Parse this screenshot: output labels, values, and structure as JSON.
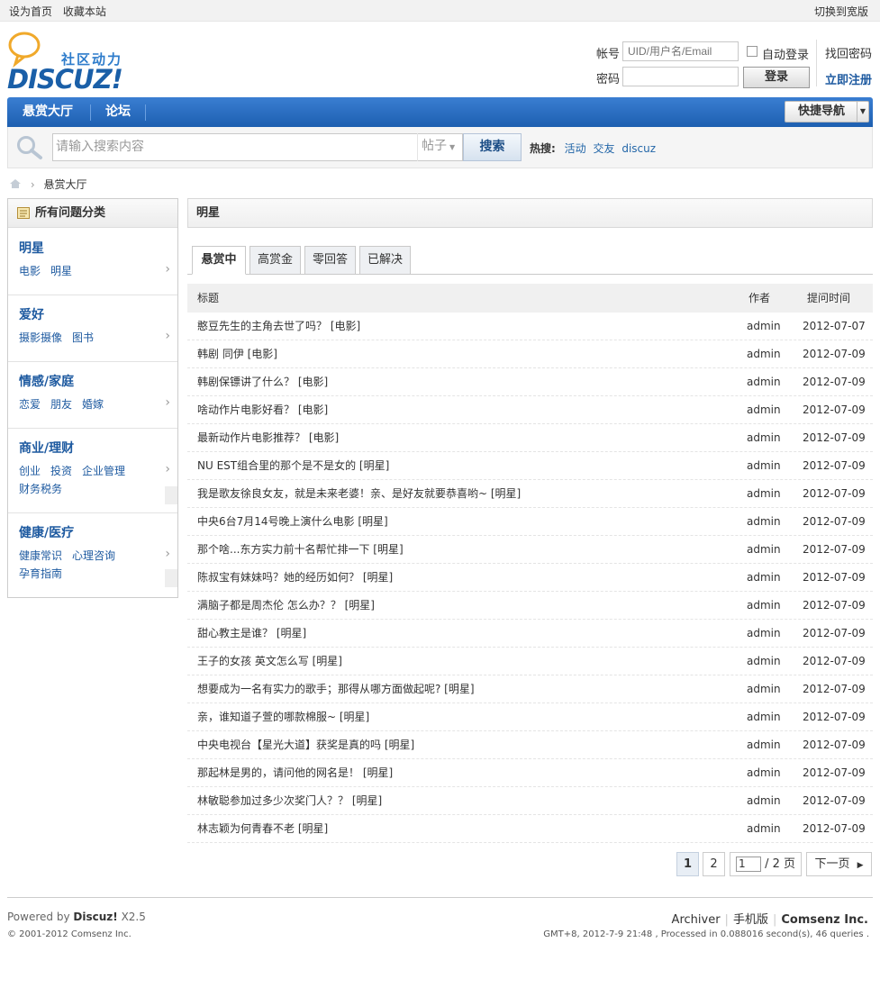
{
  "topbar": {
    "set_home": "设为首页",
    "bookmark": "收藏本站",
    "widescreen": "切换到宽版"
  },
  "logo": {
    "brand": "DISCUZ!",
    "tagline": "社区动力"
  },
  "login": {
    "account_label": "帐号",
    "account_placeholder": "UID/用户名/Email",
    "auto_login": "自动登录",
    "find_password": "找回密码",
    "password_label": "密码",
    "login_button": "登录",
    "register": "立即注册"
  },
  "nav": {
    "items": [
      "悬赏大厅",
      "论坛"
    ],
    "quick_nav": "快捷导航"
  },
  "search": {
    "placeholder": "请输入搜索内容",
    "type": "帖子",
    "button": "搜索",
    "hot_label": "热搜:",
    "hot": [
      "活动",
      "交友",
      "discuz"
    ]
  },
  "breadcrumb": {
    "current": "悬赏大厅"
  },
  "sidebar": {
    "title": "所有问题分类",
    "categories": [
      {
        "name": "明星",
        "subs": [
          "电影",
          "明星"
        ]
      },
      {
        "name": "爱好",
        "subs": [
          "摄影摄像",
          "图书"
        ]
      },
      {
        "name": "情感/家庭",
        "subs": [
          "恋爱",
          "朋友",
          "婚嫁"
        ]
      },
      {
        "name": "商业/理财",
        "subs": [
          "创业",
          "投资",
          "企业管理",
          "财务税务"
        ]
      },
      {
        "name": "健康/医疗",
        "subs": [
          "健康常识",
          "心理咨询",
          "孕育指南"
        ]
      }
    ]
  },
  "main": {
    "title": "明星",
    "tabs": [
      "悬赏中",
      "高赏金",
      "零回答",
      "已解决"
    ],
    "columns": {
      "title": "标题",
      "author": "作者",
      "time": "提问时间"
    },
    "rows": [
      {
        "title": "憨豆先生的主角去世了吗？ [电影]",
        "author": "admin",
        "time": "2012-07-07"
      },
      {
        "title": "韩剧 同伊 [电影]",
        "author": "admin",
        "time": "2012-07-09"
      },
      {
        "title": "韩剧保镖讲了什么？ [电影]",
        "author": "admin",
        "time": "2012-07-09"
      },
      {
        "title": "啥动作片电影好看？ [电影]",
        "author": "admin",
        "time": "2012-07-09"
      },
      {
        "title": "最新动作片电影推荐？ [电影]",
        "author": "admin",
        "time": "2012-07-09"
      },
      {
        "title": "NU EST组合里的那个是不是女的 [明星]",
        "author": "admin",
        "time": "2012-07-09"
      },
      {
        "title": "我是歌友徐良女友，就是未来老婆！亲、是好友就要恭喜哟~ [明星]",
        "author": "admin",
        "time": "2012-07-09"
      },
      {
        "title": "中央6台7月14号晚上演什么电影 [明星]",
        "author": "admin",
        "time": "2012-07-09"
      },
      {
        "title": "那个啥...东方实力前十名帮忙排一下 [明星]",
        "author": "admin",
        "time": "2012-07-09"
      },
      {
        "title": "陈叔宝有妹妹吗？她的经历如何？ [明星]",
        "author": "admin",
        "time": "2012-07-09"
      },
      {
        "title": "满脑子都是周杰伦 怎么办？？ [明星]",
        "author": "admin",
        "time": "2012-07-09"
      },
      {
        "title": "甜心教主是谁？ [明星]",
        "author": "admin",
        "time": "2012-07-09"
      },
      {
        "title": "王子的女孩 英文怎么写 [明星]",
        "author": "admin",
        "time": "2012-07-09"
      },
      {
        "title": "想要成为一名有实力的歌手；那得从哪方面做起呢? [明星]",
        "author": "admin",
        "time": "2012-07-09"
      },
      {
        "title": "亲，谁知道子萱的哪款棉服~ [明星]",
        "author": "admin",
        "time": "2012-07-09"
      },
      {
        "title": "中央电视台【星光大道】获奖是真的吗 [明星]",
        "author": "admin",
        "time": "2012-07-09"
      },
      {
        "title": "那起林是男的，请问他的网名是！ [明星]",
        "author": "admin",
        "time": "2012-07-09"
      },
      {
        "title": "林敏聪参加过多少次奖门人？？ [明星]",
        "author": "admin",
        "time": "2012-07-09"
      },
      {
        "title": "林志颖为何青春不老 [明星]",
        "author": "admin",
        "time": "2012-07-09"
      }
    ]
  },
  "pager": {
    "page1": "1",
    "page2": "2",
    "input_value": "1",
    "total": "/ 2 页",
    "next": "下一页"
  },
  "footer": {
    "powered_prefix": "Powered by",
    "powered_brand": "Discuz!",
    "version": "X2.5",
    "copyright": "© 2001-2012 Comsenz Inc.",
    "links": [
      "Archiver",
      "手机版"
    ],
    "company": "Comsenz Inc.",
    "gmt": "GMT+8, 2012-7-9 21:48 , Processed in 0.088016 second(s), 46 queries ."
  },
  "colors": {
    "nav_blue": "#1d5fb0",
    "link_blue": "#1e5aa0",
    "brand_blue": "#1a5fa8"
  },
  "icons": [
    "search-icon",
    "home-icon",
    "list-icon",
    "chevron-right-icon",
    "caret-down-icon",
    "logo-bubble-icon"
  ]
}
